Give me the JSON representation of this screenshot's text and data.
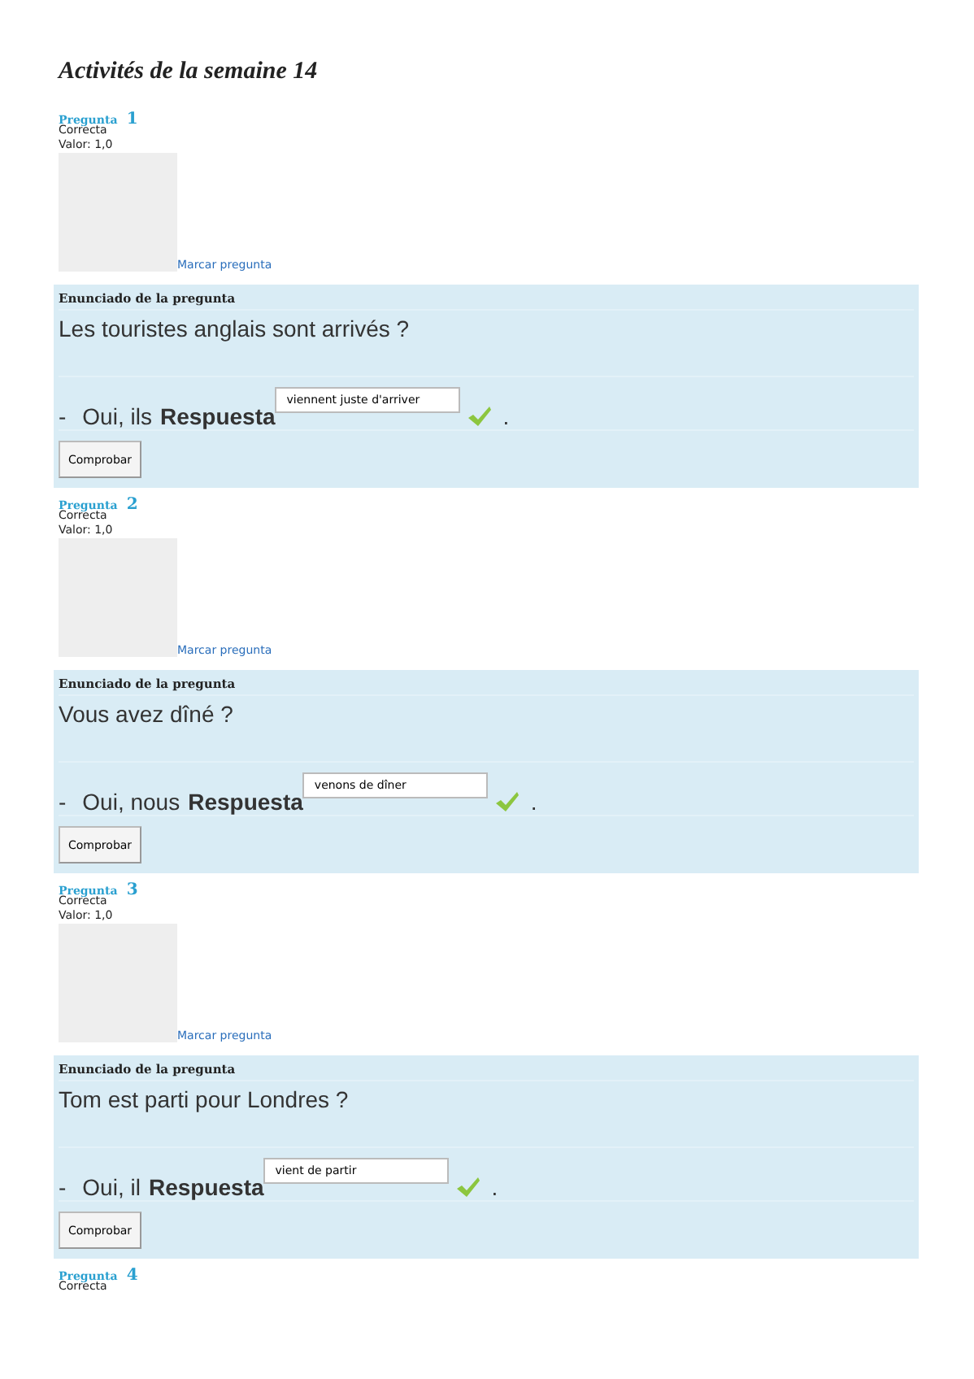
{
  "title": "Activités de la semaine 14",
  "questions": [
    {
      "label": "Pregunta",
      "number": "1",
      "state": "Correcta",
      "grade": "Valor: 1,0",
      "flag_label": "Marcar pregunta",
      "panel": {
        "heading": "Enunciado de la pregunta",
        "question": "Les touristes anglais sont arrivés ?",
        "dash": "-",
        "prefix": "Oui, ils",
        "answer_label": "Respuesta",
        "answer": "viennent juste d'arriver",
        "correct": true,
        "suffix": ".",
        "button": "Comprobar"
      }
    },
    {
      "label": "Pregunta",
      "number": "2",
      "state": "Correcta",
      "grade": "Valor: 1,0",
      "flag_label": "Marcar pregunta",
      "panel": {
        "heading": "Enunciado de la pregunta",
        "question": "Vous avez dîné ?",
        "dash": "-",
        "prefix": "Oui, nous",
        "answer_label": "Respuesta",
        "answer": "venons de dîner",
        "correct": true,
        "suffix": ".",
        "button": "Comprobar"
      }
    },
    {
      "label": "Pregunta",
      "number": "3",
      "state": "Correcta",
      "grade": "Valor: 1,0",
      "flag_label": "Marcar pregunta",
      "panel": {
        "heading": "Enunciado de la pregunta",
        "question": "Tom est parti pour Londres ?",
        "dash": "-",
        "prefix": "Oui, il",
        "answer_label": "Respuesta",
        "answer": "vient de partir",
        "correct": true,
        "suffix": ".",
        "button": "Comprobar"
      }
    },
    {
      "label": "Pregunta",
      "number": "4",
      "state": "Correcta"
    }
  ]
}
